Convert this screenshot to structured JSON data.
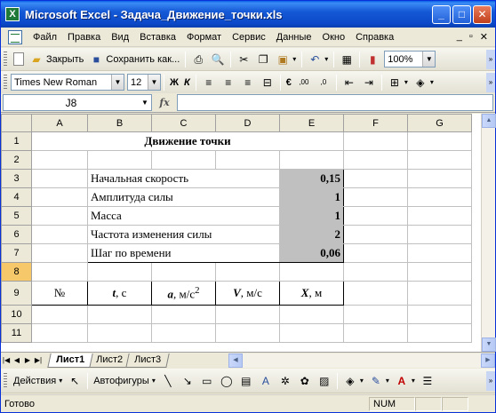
{
  "window": {
    "title": "Microsoft Excel - Задача_Движение_точки.xls",
    "app_icon": "excel-icon",
    "minimize_label": "_",
    "maximize_label": "□",
    "close_label": "✕"
  },
  "menu": {
    "items": [
      "Файл",
      "Правка",
      "Вид",
      "Вставка",
      "Формат",
      "Сервис",
      "Данные",
      "Окно",
      "Справка"
    ],
    "doc_min": "_",
    "doc_restore": "▫",
    "doc_close": "✕"
  },
  "standard_toolbar": {
    "close_label": "Закрыть",
    "save_as_label": "Сохранить как...",
    "zoom": "100%"
  },
  "format_toolbar": {
    "font": "Times New Roman",
    "size": "12",
    "bold": "Ж",
    "italic": "К",
    "currency": "€"
  },
  "formula_bar": {
    "name_box": "J8",
    "fx_label": "fx",
    "formula": ""
  },
  "columns": [
    "A",
    "B",
    "C",
    "D",
    "E",
    "F",
    "G"
  ],
  "rows": [
    "1",
    "2",
    "3",
    "4",
    "5",
    "6",
    "7",
    "8",
    "9",
    "10",
    "11"
  ],
  "sheet": {
    "title": "Движение точки",
    "params": [
      {
        "label": "Начальная скорость",
        "value": "0,15"
      },
      {
        "label": "Амплитуда силы",
        "value": "1"
      },
      {
        "label": "Масса",
        "value": "1"
      },
      {
        "label": "Частота изменения силы",
        "value": "2"
      },
      {
        "label": "Шаг по времени",
        "value": "0,06"
      }
    ],
    "table_headers": {
      "n": "№",
      "t_sym": "t",
      "t_unit": ", с",
      "a_sym": "a",
      "a_unit": ", м/с",
      "a_exp": "2",
      "v_sym": "V",
      "v_unit": ", м/с",
      "x_sym": "X",
      "x_unit": ", м"
    }
  },
  "sheet_tabs": [
    "Лист1",
    "Лист2",
    "Лист3"
  ],
  "active_tab": "Лист1",
  "drawing_toolbar": {
    "actions_label": "Действия",
    "autoshapes_label": "Автофигуры"
  },
  "status": {
    "text": "Готово",
    "num": "NUM"
  }
}
